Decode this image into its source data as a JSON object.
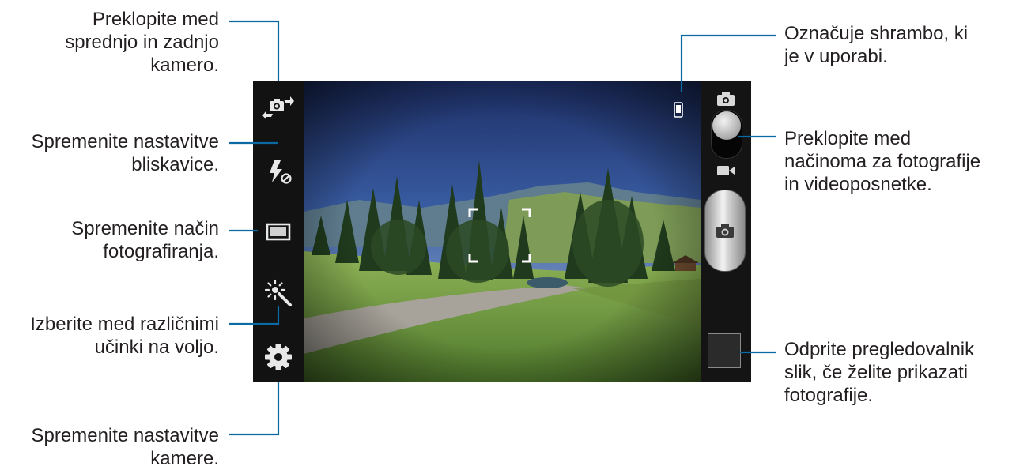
{
  "callouts": {
    "switch_camera": [
      "Preklopite med",
      "sprednjo in zadnjo",
      "kamero."
    ],
    "flash": [
      "Spremenite nastavitve",
      "bliskavice."
    ],
    "shooting_mode": [
      "Spremenite način",
      "fotografiranja."
    ],
    "effects": [
      "Izberite med različnimi",
      "učinki na voljo."
    ],
    "settings": [
      "Spremenite nastavitve",
      "kamere."
    ],
    "storage": [
      "Označuje shrambo, ki",
      "je v uporabi."
    ],
    "mode_switch": [
      "Preklopite med",
      "načinoma za fotografije",
      "in videoposnetke."
    ],
    "gallery": [
      "Odprite pregledovalnik",
      "slik, če želite prikazati",
      "fotografije."
    ]
  },
  "icons": {
    "switch_camera": "camera-switch-icon",
    "flash": "flash-off-icon",
    "shooting_mode": "shooting-mode-icon",
    "effects": "effects-wand-icon",
    "settings": "gear-icon",
    "storage": "phone-storage-icon",
    "photo_mode": "photo-camera-icon",
    "video_mode": "video-camera-icon",
    "shutter": "shutter-camera-icon"
  },
  "colors": {
    "leader_line": "#0b6aa2",
    "panel": "#121212",
    "text": "#231f20"
  }
}
